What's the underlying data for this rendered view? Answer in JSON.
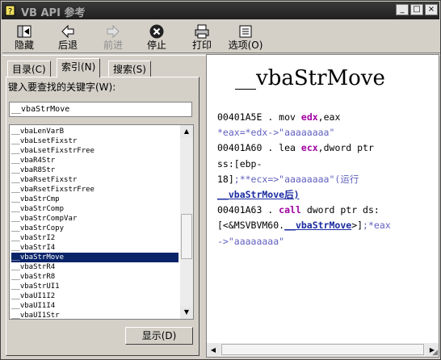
{
  "window": {
    "title": "VB API 参考"
  },
  "toolbar": {
    "buttons": [
      {
        "label": "隐藏",
        "icon": "hide-icon",
        "enabled": true
      },
      {
        "label": "后退",
        "icon": "back-arrow-icon",
        "enabled": true
      },
      {
        "label": "前进",
        "icon": "forward-arrow-icon",
        "enabled": false
      },
      {
        "label": "停止",
        "icon": "stop-icon",
        "enabled": true
      },
      {
        "label": "打印",
        "icon": "printer-icon",
        "enabled": true
      },
      {
        "label": "选项(O)",
        "icon": "options-icon",
        "enabled": true
      }
    ]
  },
  "tabs": [
    {
      "label": "目录(C)",
      "active": false
    },
    {
      "label": "索引(N)",
      "active": true
    },
    {
      "label": "搜索(S)",
      "active": false
    }
  ],
  "index": {
    "prompt": "键入要查找的关键字(W):",
    "keyword": "__vbaStrMove",
    "items": [
      "__vbaLenVarB",
      "__vbaLsetFixstr",
      "__vbaLsetFixstrFree",
      "__vbaR4Str",
      "__vbaR8Str",
      "__vbaRsetFixstr",
      "__vbaRsetFixstrFree",
      "__vbaStrCmp",
      "__vbaStrComp",
      "__vbaStrCompVar",
      "__vbaStrCopy",
      "__vbaStrI2",
      "__vbaStrI4",
      "__vbaStrMove",
      "__vbaStrR4",
      "__vbaStrR8",
      "__vbaStrUI1",
      "__vbaUI1I2",
      "__vbaUI1I4",
      "__vbaUI1Str"
    ],
    "selected_index": 13,
    "show_button": "显示(D)"
  },
  "topic": {
    "heading": "__vbaStrMove",
    "lines": [
      {
        "addr": "00401A5E",
        "op": "mov",
        "reg": "edx",
        "rest": ",eax"
      },
      {
        "comment": "*eax=*edx->\"aaaaaaaa\""
      },
      {
        "addr": "00401A60",
        "op": "lea",
        "reg": "ecx",
        "rest": ",dword ptr"
      },
      {
        "text": "ss:[ebp-"
      },
      {
        "text": "18]",
        "comment": ";**ecx=>\"aaaaaaaa\"(运行"
      },
      {
        "link": "__vbaStrMove",
        "suffix": "后)"
      },
      {
        "addr": "00401A63",
        "op": "call",
        "rest": " dword ptr ds:"
      },
      {
        "text": "[<&MSVBVM60.",
        "link": "__vbaStrMove",
        "suffix": ">]",
        "comment": ";*eax"
      },
      {
        "comment": "->\"aaaaaaaa\""
      }
    ]
  }
}
